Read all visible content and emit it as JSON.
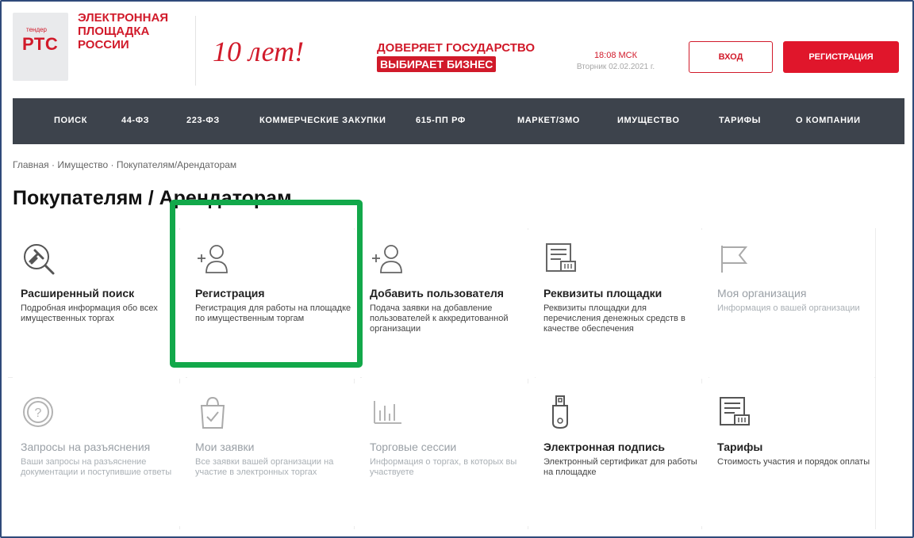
{
  "header": {
    "logo_small": "тендер",
    "logo_brand": "РТС",
    "logo_name": "ЭЛЕКТРОННАЯ ПЛОЩАДКА РОССИИ",
    "anniversary": "10 лет!",
    "trust_line1": "ДОВЕРЯЕТ ГОСУДАРСТВО",
    "trust_line2": "ВЫБИРАЕТ БИЗНЕС",
    "time": "18:08 МСК",
    "date": "Вторник 02.02.2021 г.",
    "login_label": "ВХОД",
    "register_label": "РЕГИСТРАЦИЯ"
  },
  "nav": {
    "items": [
      "ПОИСК",
      "44-ФЗ",
      "223-ФЗ",
      "КОММЕРЧЕСКИЕ ЗАКУПКИ",
      "615-ПП РФ",
      "МАРКЕТ/ЗМО",
      "ИМУЩЕСТВО",
      "ТАРИФЫ",
      "О КОМПАНИИ"
    ]
  },
  "breadcrumb": "Главная · Имущество · Покупателям/Арендаторам",
  "page_title": "Покупателям / Арендаторам",
  "cards": [
    {
      "icon": "search-icon",
      "title": "Расширенный поиск",
      "desc": "Подробная информация обо всех имущественных торгах"
    },
    {
      "icon": "add-user-icon",
      "title": "Регистрация",
      "desc": "Регистрация для работы на площадке по имущественным торгам"
    },
    {
      "icon": "add-user-icon",
      "title": "Добавить пользователя",
      "desc": "Подача заявки на добавление пользователей к аккредитованной организации"
    },
    {
      "icon": "document-icon",
      "title": "Реквизиты площадки",
      "desc": "Реквизиты площадки для перечисления денежных средств в качестве обеспечения"
    },
    {
      "icon": "flag-icon",
      "title": "Моя организация",
      "desc": "Информация о вашей организации"
    },
    {
      "icon": "question-icon",
      "title": "Запросы на разъяснения",
      "desc": "Ваши запросы на разъяснение документации и поступившие ответы"
    },
    {
      "icon": "shopping-bag-icon",
      "title": "Мои заявки",
      "desc": "Все заявки вашей организации на участие в электронных торгах"
    },
    {
      "icon": "bar-chart-icon",
      "title": "Торговые сессии",
      "desc": "Информация о торгах, в которых вы участвуете"
    },
    {
      "icon": "usb-token-icon",
      "title": "Электронная подпись",
      "desc": "Электронный сертификат для работы на площадке"
    },
    {
      "icon": "document-icon",
      "title": "Тарифы",
      "desc": "Стоимость участия и порядок оплаты"
    }
  ],
  "colors": {
    "brand_red": "#d11a2a",
    "nav_bg": "#3d434c",
    "highlight_green": "#12a84a"
  }
}
